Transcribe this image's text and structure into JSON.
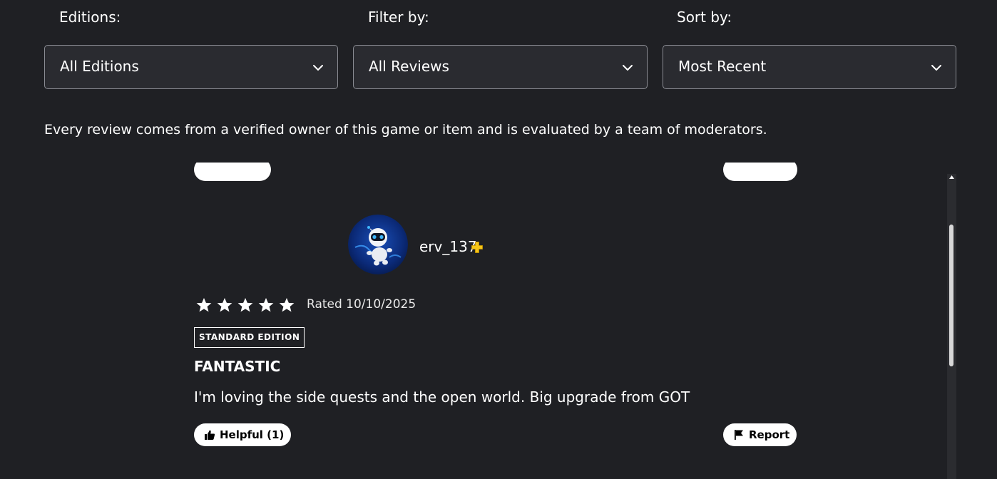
{
  "filters": {
    "editions": {
      "label": "Editions:",
      "value": "All Editions"
    },
    "filter_by": {
      "label": "Filter by:",
      "value": "All Reviews"
    },
    "sort_by": {
      "label": "Sort by:",
      "value": "Most Recent"
    }
  },
  "notice": "Every review comes from a verified owner of this game or item and is evaluated by a team of moderators.",
  "review": {
    "username": "erv_137",
    "rating_stars": 5,
    "rated_date": "Rated 10/10/2025",
    "edition_badge": "STANDARD EDITION",
    "title": "FANTASTIC",
    "body": "I'm loving the side quests and the open world. Big upgrade from GOT",
    "helpful_label": "Helpful (1)",
    "report_label": "Report"
  },
  "icons": {
    "plus_badge": "playstation-plus-icon",
    "helpful": "thumbs-up-icon",
    "report": "flag-icon",
    "dropdown": "chevron-down-icon",
    "rating": "star-icon"
  },
  "colors": {
    "background": "#1f2024",
    "select_bg": "#2a2b30",
    "select_border": "#8a8c93",
    "plus_gold": "#f5c518",
    "pill_bg": "#ffffff"
  }
}
